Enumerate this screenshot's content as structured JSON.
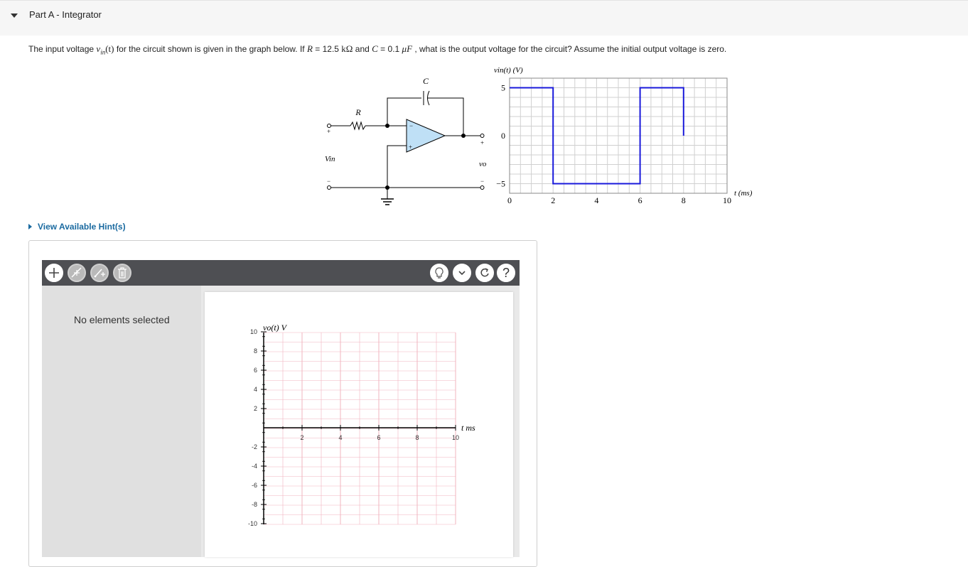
{
  "part": {
    "title": "Part A - Integrator"
  },
  "question": {
    "t1": "The input voltage ",
    "vin_sym": "v",
    "vin_sub": "in",
    "vin_arg": "(t)",
    "t2": " for the circuit shown is given in the graph below. If ",
    "r_sym": "R",
    "t3": " = 12.5 ",
    "r_unit": "kΩ",
    "t4": " and ",
    "c_sym": "C",
    "t5": " = 0.1 ",
    "c_unit": "μF",
    "t6": " , what is the output voltage for the circuit? Assume the initial output voltage is zero."
  },
  "circuit": {
    "r_label": "R",
    "c_label": "C",
    "vin_label": "Vin",
    "vo_label": "vo",
    "plus": "+",
    "minus": "−"
  },
  "input_graph": {
    "ylabel": "vin(t) (V)",
    "xlabel": "t (ms)",
    "ytick_labels": [
      "5",
      "0",
      "−5"
    ],
    "xtick_labels": [
      "0",
      "2",
      "4",
      "6",
      "8",
      "10"
    ],
    "line_color": "#1a1adb"
  },
  "chart_data": {
    "type": "line",
    "title": "",
    "xlabel": "t (ms)",
    "ylabel": "vin(t) (V)",
    "xlim": [
      0,
      10
    ],
    "ylim": [
      -6,
      6
    ],
    "grid": true,
    "series": [
      {
        "x": [
          0,
          2,
          2,
          6,
          6,
          8,
          8
        ],
        "y": [
          5,
          5,
          -5,
          -5,
          5,
          5,
          0
        ]
      }
    ]
  },
  "hints": {
    "label": "View Available Hint(s)"
  },
  "toolbar": {
    "left_tools": [
      "plus-icon",
      "line-tool-icon",
      "point-tool-icon",
      "trash-icon"
    ],
    "right_tools": [
      "lightbulb-icon",
      "chevron-down-icon",
      "reset-icon",
      "help-icon"
    ],
    "help_glyph": "?"
  },
  "side_panel": {
    "empty_message": "No elements selected"
  },
  "answer_plot": {
    "ylabel": "vo(t) V",
    "xlabel": "t ms",
    "ytick_labels": [
      "10",
      "8",
      "6",
      "4",
      "2",
      "-2",
      "-4",
      "-6",
      "-8",
      "-10"
    ],
    "xtick_labels": [
      "2",
      "4",
      "6",
      "8",
      "10"
    ],
    "grid_color": "#f2b4bf"
  }
}
